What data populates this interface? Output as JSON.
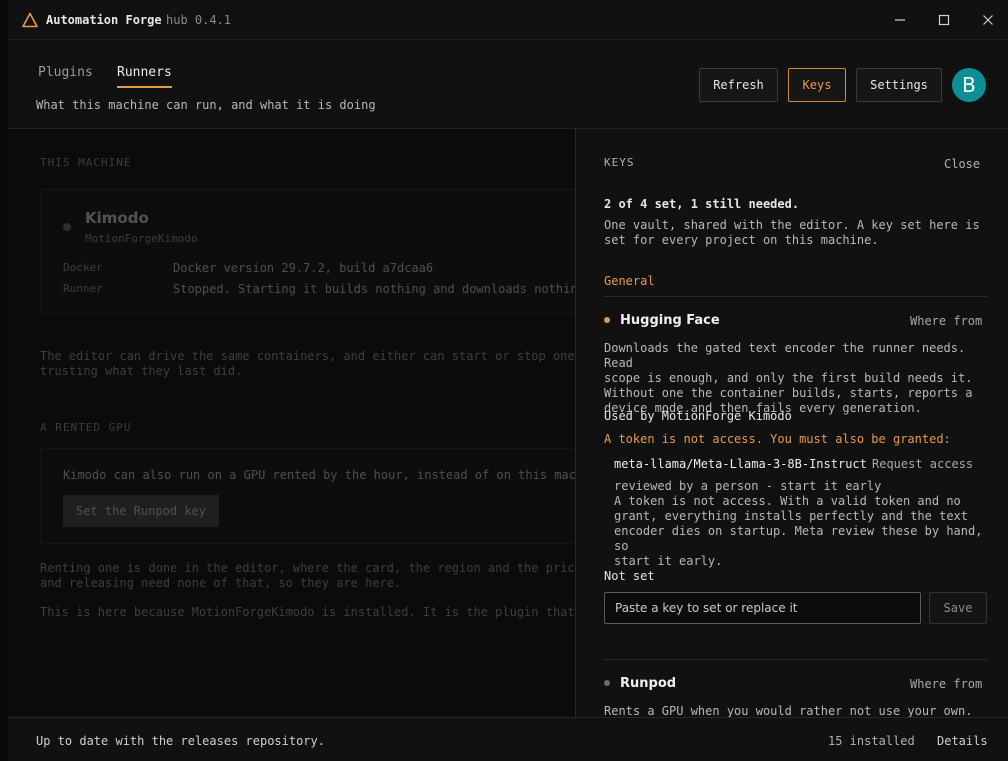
{
  "titlebar": {
    "app_name": "Automation Forge",
    "version": "hub 0.4.1",
    "minimize_glyph": "—",
    "maximize_glyph": "☐",
    "close_glyph": "✕"
  },
  "header": {
    "tabs": [
      {
        "label": "Plugins",
        "active": false
      },
      {
        "label": "Runners",
        "active": true
      }
    ],
    "subtitle": "What this machine can run, and what it is doing",
    "buttons": {
      "refresh": "Refresh",
      "keys": "Keys",
      "settings": "Settings"
    },
    "avatar_letter": "B"
  },
  "machine": {
    "section_label": "THIS MACHINE",
    "runner_name": "Kimodo",
    "runner_plugin": "MotionForgeKimodo",
    "rows": [
      {
        "key": "Docker",
        "value": "Docker version 29.7.2, build a7dcaa6"
      },
      {
        "key": "Runner",
        "value": "Stopped. Starting it builds nothing and downloads nothing."
      }
    ],
    "note_lines": [
      "The editor can drive the same containers, and either can start or stop one wi",
      "trusting what they last did."
    ]
  },
  "rented_gpu": {
    "section_label": "A RENTED GPU",
    "text": "Kimodo can also run on a GPU rented by the hour, instead of on this machin",
    "button": "Set the Runpod key",
    "note_lines": [
      "Renting one is done in the editor, where the card, the region and the price ca",
      "and releasing need none of that, so they are here."
    ],
    "because": "This is here because MotionForgeKimodo is installed. It is the plugin that can"
  },
  "keys_panel": {
    "title": "KEYS",
    "close": "Close",
    "summary": "2 of 4 set, 1 still needed.",
    "vault_lines": [
      "One vault, shared with the editor. A key set here is",
      "set for every project on this machine."
    ],
    "group": "General",
    "hugging_face": {
      "name": "Hugging Face",
      "where": "Where from",
      "desc_lines": [
        "Downloads the gated text encoder the runner needs. Read",
        "scope is enough, and only the first build needs it.",
        "Without one the container builds, starts, reports a",
        "device mode and then fails every generation."
      ],
      "used_by": "Used by MotionForge Kimodo",
      "warning": "A token is not access. You must also be granted:",
      "model": "meta-llama/Meta-Llama-3-8B-Instruct",
      "request": "Request access",
      "review_lines": [
        "reviewed by a person - start it early",
        "A token is not access. With a valid token and no",
        "grant, everything installs perfectly and the text",
        "encoder dies on startup. Meta review these by hand, so",
        "start it early."
      ],
      "status": "Not set",
      "placeholder": "Paste a key to set or replace it",
      "save": "Save"
    },
    "runpod": {
      "name": "Runpod",
      "where": "Where from",
      "desc": "Rents a GPU when you would rather not use your own."
    },
    "colors": {
      "accent": "#e59a4c",
      "unset_dot": "#e59a4c",
      "neutral_dot": "#6a6a6a"
    }
  },
  "statusbar": {
    "status": "Up to date with the releases repository.",
    "installed": "15 installed",
    "details": "Details"
  }
}
